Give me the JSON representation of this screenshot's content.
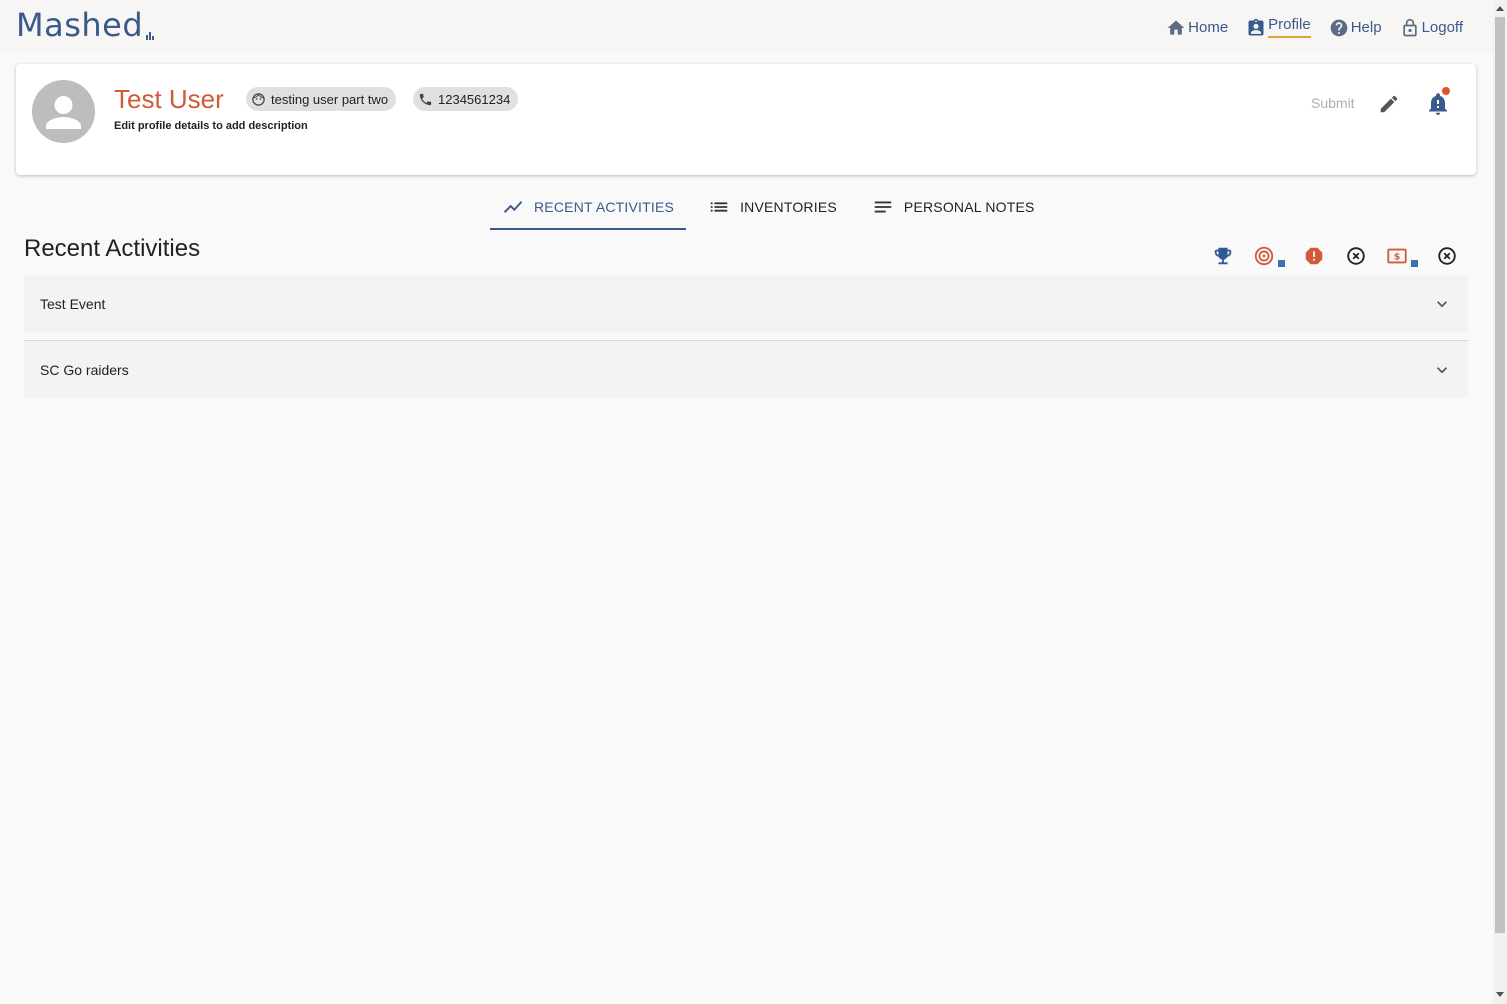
{
  "app": {
    "logo_text": "Mashed"
  },
  "nav": {
    "items": [
      {
        "label": "Home",
        "icon": "home-icon"
      },
      {
        "label": "Profile",
        "icon": "profile-badge-icon",
        "active": true
      },
      {
        "label": "Help",
        "icon": "help-icon"
      },
      {
        "label": "Logoff",
        "icon": "lock-icon"
      }
    ]
  },
  "profile": {
    "name": "Test User",
    "username_chip": "testing user part two",
    "phone_chip": "1234561234",
    "description": "Edit profile details to add description",
    "submit_label": "Submit"
  },
  "tabs": [
    {
      "label": "RECENT ACTIVITIES",
      "icon": "trending-line-icon",
      "active": true
    },
    {
      "label": "INVENTORIES",
      "icon": "list-icon"
    },
    {
      "label": "PERSONAL NOTES",
      "icon": "notes-icon"
    }
  ],
  "section": {
    "title": "Recent Activities"
  },
  "status_icons": [
    "trophy-icon",
    "target-icon",
    "alert-octagon-icon",
    "cancel-circle-icon",
    "money-icon",
    "cancel-circle-icon"
  ],
  "activities": [
    {
      "label": "Test Event"
    },
    {
      "label": "SC Go raiders"
    }
  ],
  "colors": {
    "brand": "#3a5a8c",
    "accent_orange": "#d05a3a",
    "underline": "#e0a23a"
  }
}
